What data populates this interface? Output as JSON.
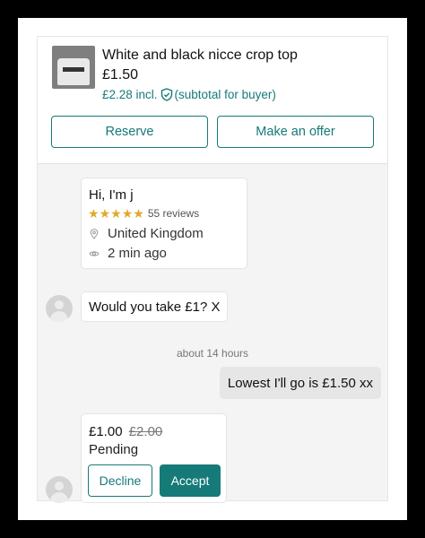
{
  "item": {
    "title": "White and black nicce crop top",
    "price": "£1.50",
    "incl_price": "£2.28 incl.",
    "subtotal_note": "(subtotal for buyer)"
  },
  "actions": {
    "reserve_label": "Reserve",
    "offer_label": "Make an offer"
  },
  "profile": {
    "greeting": "Hi, I'm j",
    "rating_stars": 5,
    "reviews": "55 reviews",
    "location": "United Kingdom",
    "last_seen": "2 min ago"
  },
  "messages": {
    "incoming": "Would you take £1? X",
    "timestamp": "about 14 hours",
    "outgoing": "Lowest I'll go is £1.50 xx"
  },
  "offer": {
    "amount": "£1.00",
    "original": "£2.00",
    "status": "Pending",
    "decline_label": "Decline",
    "accept_label": "Accept"
  },
  "icons": {
    "thumbnail": "product-thumbnail",
    "shield": "shield-check-icon",
    "star": "star-icon",
    "location": "location-pin-icon",
    "eye": "eye-icon",
    "avatar": "user-avatar"
  },
  "colors": {
    "accent": "#157a78",
    "star": "#e3a82b",
    "outgoing_bubble": "#e6e6e6"
  }
}
